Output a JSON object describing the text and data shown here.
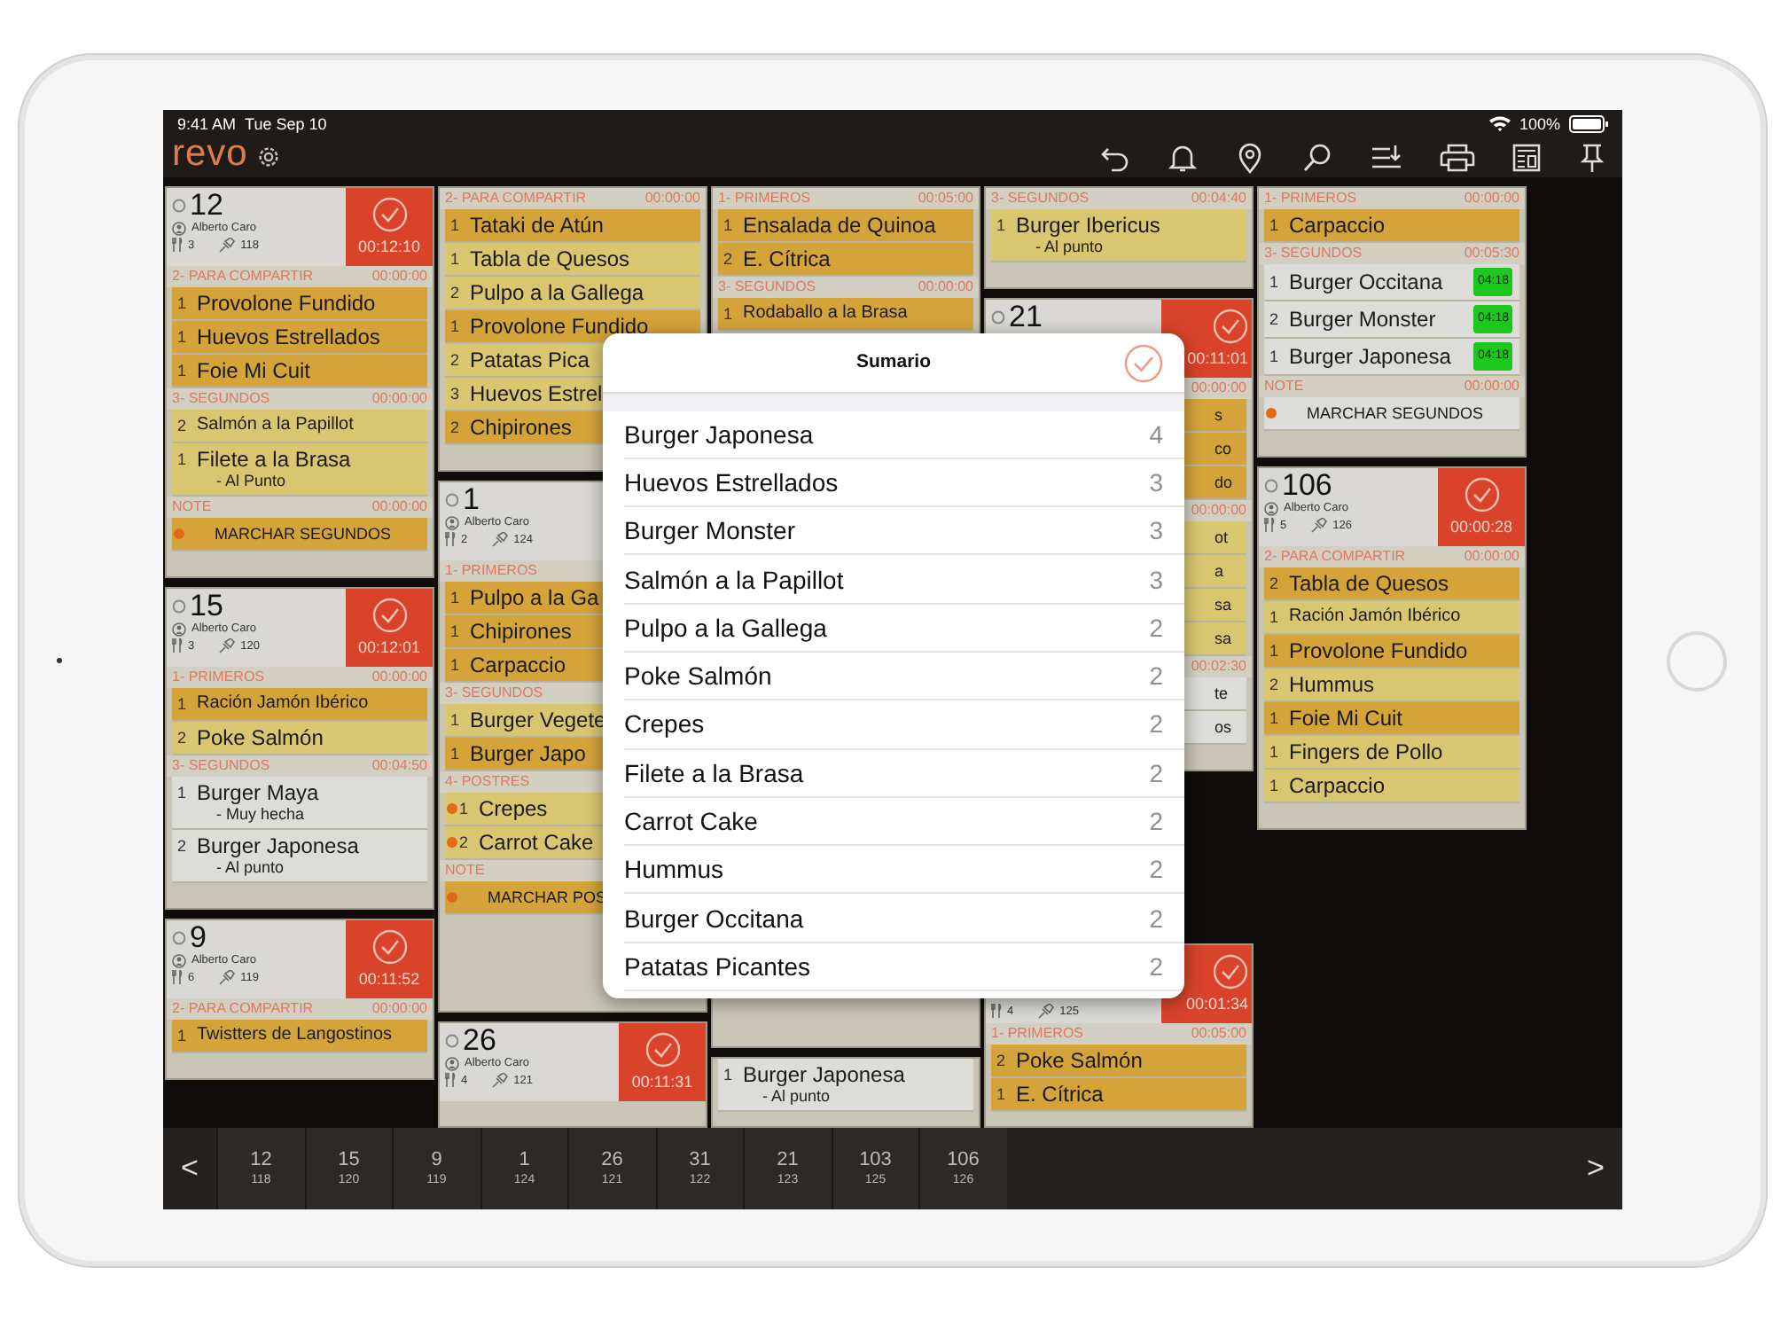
{
  "status_bar": {
    "time": "9:41 AM",
    "date": "Tue Sep 10",
    "battery": "100%"
  },
  "app": {
    "logo": "revo"
  },
  "columns": [
    {
      "cards": [
        {
          "number": "12",
          "waiter": "Alberto Caro",
          "guests": "3",
          "ticket": "118",
          "elapsed": "00:12:10",
          "sections": [
            {
              "title": "2- PARA COMPARTIR",
              "time": "00:00:00",
              "items": [
                {
                  "qty": "1",
                  "name": "Provolone Fundido",
                  "kind": "fired"
                },
                {
                  "qty": "1",
                  "name": "Huevos Estrellados",
                  "kind": "fired"
                },
                {
                  "qty": "1",
                  "name": "Foie Mi Cuit",
                  "kind": "fired"
                }
              ]
            },
            {
              "title": "3- SEGUNDOS",
              "time": "00:00:00",
              "items": [
                {
                  "qty": "2",
                  "name": "Salmón a la Papillot",
                  "kind": "pending"
                },
                {
                  "qty": "1",
                  "name": "Filete a la Brasa",
                  "note": "- Al Punto",
                  "kind": "pending"
                }
              ]
            },
            {
              "title": "NOTE",
              "time": "00:00:00",
              "items": [
                {
                  "name": "MARCHAR SEGUNDOS",
                  "kind": "fired",
                  "marked": true
                }
              ]
            }
          ]
        },
        {
          "number": "15",
          "waiter": "Alberto Caro",
          "guests": "3",
          "ticket": "120",
          "elapsed": "00:12:01",
          "sections": [
            {
              "title": "1- PRIMEROS",
              "time": "00:00:00",
              "items": [
                {
                  "qty": "1",
                  "name": "Ración Jamón Ibérico",
                  "kind": "fired"
                },
                {
                  "qty": "2",
                  "name": "Poke Salmón",
                  "kind": "pending"
                }
              ]
            },
            {
              "title": "3- SEGUNDOS",
              "time": "00:04:50",
              "items": [
                {
                  "qty": "1",
                  "name": "Burger Maya",
                  "note": "- Muy hecha",
                  "kind": "held"
                },
                {
                  "qty": "2",
                  "name": "Burger Japonesa",
                  "note": "- Al punto",
                  "kind": "held"
                }
              ]
            }
          ]
        },
        {
          "number": "9",
          "waiter": "Alberto Caro",
          "guests": "6",
          "ticket": "119",
          "elapsed": "00:11:52",
          "sections": [
            {
              "title": "2- PARA COMPARTIR",
              "time": "00:00:00",
              "items": [
                {
                  "qty": "1",
                  "name": "Twistters de Langostinos",
                  "kind": "fired"
                }
              ]
            }
          ]
        }
      ]
    },
    {
      "cards": [
        {
          "sections": [
            {
              "title": "2- PARA COMPARTIR",
              "time": "00:00:00",
              "items": [
                {
                  "qty": "1",
                  "name": "Tataki de Atún",
                  "kind": "fired"
                },
                {
                  "qty": "1",
                  "name": "Tabla de Quesos",
                  "kind": "pending"
                },
                {
                  "qty": "2",
                  "name": "Pulpo a la Gallega",
                  "kind": "pending"
                },
                {
                  "qty": "1",
                  "name": "Provolone Fundido",
                  "kind": "fired"
                },
                {
                  "qty": "2",
                  "name": "Patatas Pica",
                  "kind": "pending"
                },
                {
                  "qty": "3",
                  "name": "Huevos Estrel",
                  "kind": "pending"
                },
                {
                  "qty": "2",
                  "name": "Chipirones",
                  "kind": "fired"
                }
              ]
            }
          ]
        },
        {
          "kind": "under_right",
          "number": "1",
          "waiter": "Alberto Caro",
          "guests": "2",
          "ticket": "124",
          "sections": [
            {
              "title": "1- PRIMEROS",
              "items": [
                {
                  "qty": "1",
                  "name": "Pulpo a la Ga",
                  "kind": "fired"
                },
                {
                  "qty": "1",
                  "name": "Chipirones",
                  "kind": "fired"
                },
                {
                  "qty": "1",
                  "name": "Carpaccio",
                  "kind": "fired"
                }
              ]
            },
            {
              "title": "3- SEGUNDOS",
              "items": [
                {
                  "qty": "1",
                  "name": "Burger Vegete",
                  "kind": "pending"
                },
                {
                  "qty": "1",
                  "name": "Burger Japo",
                  "kind": "fired"
                }
              ]
            },
            {
              "title": "4- POSTRES",
              "items": [
                {
                  "qty": "1",
                  "name": "Crepes",
                  "kind": "pending",
                  "marked": true
                },
                {
                  "qty": "2",
                  "name": "Carrot Cake",
                  "kind": "pending",
                  "marked": true
                }
              ]
            },
            {
              "title": "NOTE",
              "items": [
                {
                  "name": "MARCHAR POS",
                  "kind": "fired",
                  "marked": true
                }
              ]
            }
          ]
        },
        {
          "number": "26",
          "waiter": "Alberto Caro",
          "guests": "4",
          "ticket": "121",
          "elapsed": "00:11:31"
        }
      ]
    },
    {
      "cards": [
        {
          "kind": "under_bottom",
          "sections": [
            {
              "title": "1- PRIMEROS",
              "time": "00:05:00",
              "items": [
                {
                  "qty": "1",
                  "name": "Ensalada de Quinoa",
                  "kind": "fired"
                },
                {
                  "qty": "2",
                  "name": "E. Cítrica",
                  "kind": "fired"
                }
              ]
            },
            {
              "title": "3- SEGUNDOS",
              "time": "00:00:00",
              "items": [
                {
                  "qty": "1",
                  "name": "Rodaballo a la Brasa",
                  "kind": "fired"
                }
              ]
            }
          ]
        },
        {
          "kind": "under_top",
          "sections": [
            {
              "items": [
                {
                  "qty": "1",
                  "name": "Burger Japonesa",
                  "note": "- Al punto",
                  "kind": "held"
                }
              ]
            }
          ]
        }
      ]
    },
    {
      "cards": [
        {
          "sections": [
            {
              "title": "3- SEGUNDOS",
              "time": "00:04:40",
              "items": [
                {
                  "qty": "1",
                  "name": "Burger Ibericus",
                  "note": "- Al punto",
                  "kind": "pending"
                }
              ]
            }
          ]
        },
        {
          "kind": "under_left",
          "number": "21",
          "elapsed": "00:11:01",
          "sections": [
            {
              "time": "00:00:00",
              "items": [
                {
                  "name": "s",
                  "kind": "fired"
                },
                {
                  "name": "co",
                  "kind": "fired"
                },
                {
                  "name": "do",
                  "kind": "fired"
                }
              ]
            },
            {
              "time": "00:00:00",
              "items": [
                {
                  "name": "ot",
                  "kind": "pending"
                },
                {
                  "name": "a",
                  "kind": "pending"
                },
                {
                  "name": "sa",
                  "kind": "pending"
                },
                {
                  "name": "sa",
                  "kind": "pending"
                }
              ]
            },
            {
              "time": "00:02:30",
              "items": [
                {
                  "name": "te",
                  "kind": "held"
                },
                {
                  "name": "os",
                  "kind": "held"
                }
              ]
            }
          ]
        },
        {
          "kind": "under_top",
          "guests": "4",
          "ticket": "125",
          "elapsed": "00:01:34",
          "sections": [
            {
              "title": "1- PRIMEROS",
              "time": "00:05:00",
              "items": [
                {
                  "qty": "2",
                  "name": "Poke Salmón",
                  "kind": "fired"
                },
                {
                  "qty": "1",
                  "name": "E. Cítrica",
                  "kind": "fired"
                }
              ]
            }
          ]
        }
      ]
    },
    {
      "cards": [
        {
          "sections": [
            {
              "title": "1- PRIMEROS",
              "time": "00:00:00",
              "items": [
                {
                  "qty": "1",
                  "name": "Carpaccio",
                  "kind": "fired"
                }
              ]
            },
            {
              "title": "3- SEGUNDOS",
              "time": "00:05:30",
              "items": [
                {
                  "qty": "1",
                  "name": "Burger Occitana",
                  "kind": "held",
                  "timer": "04:18"
                },
                {
                  "qty": "2",
                  "name": "Burger Monster",
                  "kind": "held",
                  "timer": "04:18"
                },
                {
                  "qty": "1",
                  "name": "Burger Japonesa",
                  "kind": "held",
                  "timer": "04:18"
                }
              ]
            },
            {
              "title": "NOTE",
              "time": "00:00:00",
              "items": [
                {
                  "name": "MARCHAR SEGUNDOS",
                  "kind": "held",
                  "marked": true
                }
              ]
            }
          ]
        },
        {
          "number": "106",
          "waiter": "Alberto Caro",
          "guests": "5",
          "ticket": "126",
          "elapsed": "00:00:28",
          "sections": [
            {
              "title": "2- PARA COMPARTIR",
              "time": "00:00:00",
              "items": [
                {
                  "qty": "2",
                  "name": "Tabla de Quesos",
                  "kind": "fired"
                },
                {
                  "qty": "1",
                  "name": "Ración Jamón Ibérico",
                  "kind": "pending"
                },
                {
                  "qty": "1",
                  "name": "Provolone Fundido",
                  "kind": "fired"
                },
                {
                  "qty": "2",
                  "name": "Hummus",
                  "kind": "pending"
                },
                {
                  "qty": "1",
                  "name": "Foie Mi Cuit",
                  "kind": "fired"
                },
                {
                  "qty": "1",
                  "name": "Fingers de Pollo",
                  "kind": "pending"
                },
                {
                  "qty": "1",
                  "name": "Carpaccio",
                  "kind": "pending"
                }
              ]
            }
          ]
        }
      ]
    }
  ],
  "summary": {
    "title": "Sumario",
    "rows": [
      {
        "name": "Burger Japonesa",
        "count": "4"
      },
      {
        "name": "Huevos Estrellados",
        "count": "3"
      },
      {
        "name": "Burger Monster",
        "count": "3"
      },
      {
        "name": "Salmón a la Papillot",
        "count": "3"
      },
      {
        "name": "Pulpo a la Gallega",
        "count": "2"
      },
      {
        "name": "Poke Salmón",
        "count": "2"
      },
      {
        "name": "Crepes",
        "count": "2"
      },
      {
        "name": "Filete a la Brasa",
        "count": "2"
      },
      {
        "name": "Carrot Cake",
        "count": "2"
      },
      {
        "name": "Hummus",
        "count": "2"
      },
      {
        "name": "Burger Occitana",
        "count": "2"
      },
      {
        "name": "Patatas Picantes",
        "count": "2"
      }
    ]
  },
  "bottom_bar": {
    "prev": "<",
    "next": ">",
    "tabs": [
      {
        "number": "12",
        "ticket": "118",
        "selected": false
      },
      {
        "number": "15",
        "ticket": "120",
        "selected": false
      },
      {
        "number": "9",
        "ticket": "119",
        "selected": false
      },
      {
        "number": "1",
        "ticket": "124",
        "selected": false
      },
      {
        "number": "26",
        "ticket": "121",
        "selected": false
      },
      {
        "number": "31",
        "ticket": "122",
        "selected": false
      },
      {
        "number": "21",
        "ticket": "123",
        "selected": false
      },
      {
        "number": "103",
        "ticket": "125",
        "selected": false
      },
      {
        "number": "106",
        "ticket": "126",
        "selected": false
      }
    ]
  }
}
